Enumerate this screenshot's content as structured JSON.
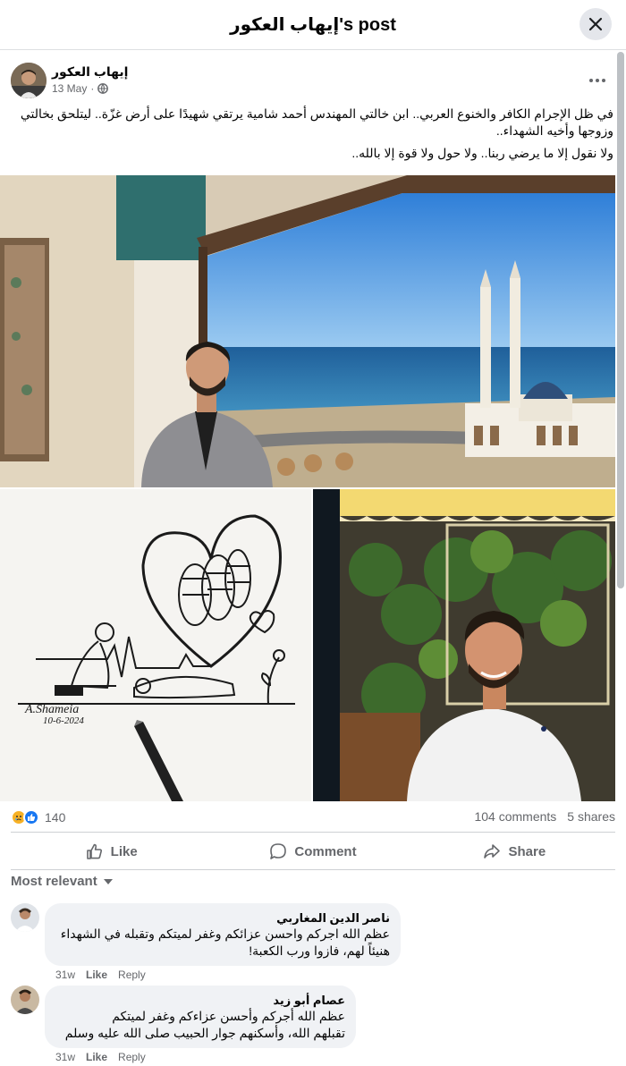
{
  "header": {
    "title": "إيهاب العكور's post"
  },
  "post": {
    "author": "إيهاب العكور",
    "date": "13 May",
    "dot": "·",
    "text_line1": "في ظل الإجرام الكافر والخنوع العربي.. ابن خالتي المهندس أحمد شامية يرتقي شهيدًا على أرض غزّة.. ليتلحق بخالتي وزوجها وأخيه الشهداء..",
    "text_line2": "ولا نقول إلا ما يرضي ربنا.. ولا حول ولا قوة إلا بالله..",
    "drawing_signature": "A.Shameia",
    "drawing_date": "10-6-2024"
  },
  "stats": {
    "reaction_count": "140",
    "comments": "104 comments",
    "shares": "5 shares"
  },
  "actions": {
    "like": "Like",
    "comment": "Comment",
    "share": "Share"
  },
  "sort": {
    "label": "Most relevant"
  },
  "comments": [
    {
      "name": "ناصر الدين المغاربي",
      "line1": "عظم الله اجركم واحسن عزائكم وغفر لميتكم وتقبله في الشهداء",
      "line2": "هنيئاً لهم، فازوا ورب الكعبة!",
      "time": "31w",
      "like": "Like",
      "reply": "Reply"
    },
    {
      "name": "عصام أبو زيد",
      "line1": "عظم الله أجركم وأحسن عزاءكم وغفر لميتكم",
      "line2": "تقبلهم الله، وأسكنهم جوار الحبيب صلى الله عليه وسلم",
      "time": "31w",
      "like": "Like",
      "reply": "Reply"
    }
  ],
  "colors": {
    "like_blue": "#1877f2",
    "sad_yellow": "#f7b125",
    "muted": "#65676b"
  }
}
